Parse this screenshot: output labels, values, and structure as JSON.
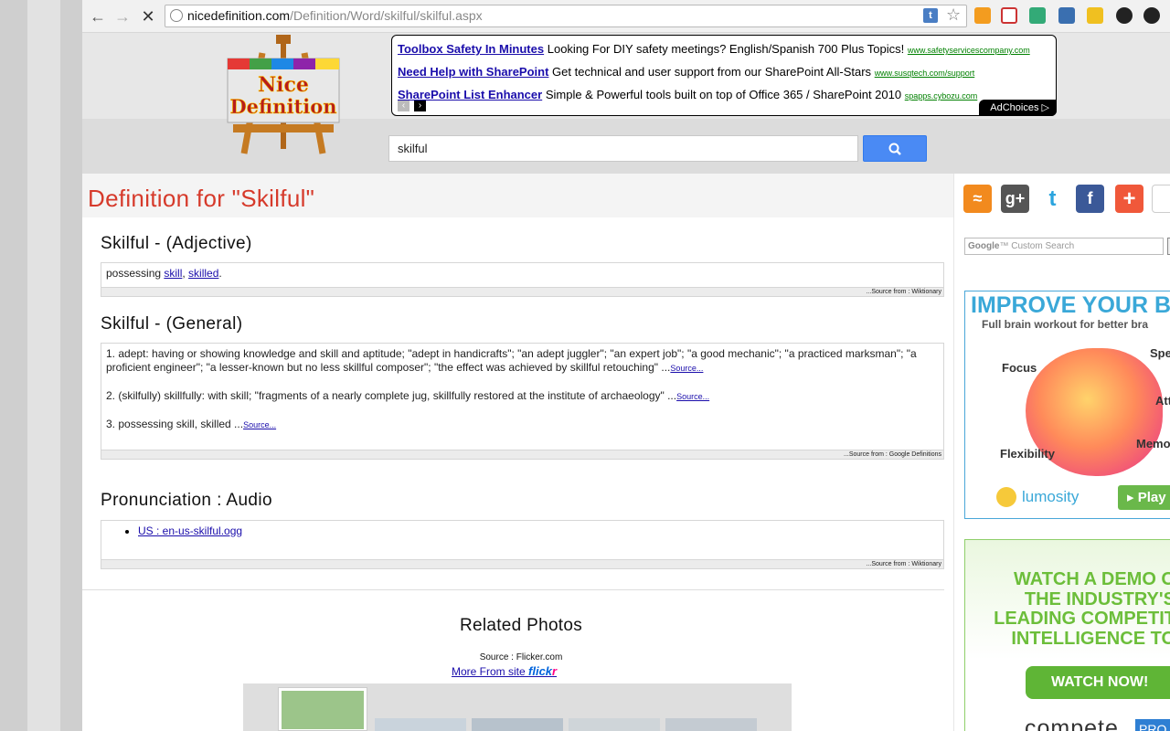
{
  "browser": {
    "url_domain": "nicedefinition.com",
    "url_path": "/Definition/Word/skilful/skilful.aspx",
    "icons": [
      "back-icon",
      "forward-icon",
      "stop-icon",
      "globe-icon",
      "star-icon"
    ]
  },
  "ads": {
    "lines": [
      {
        "title": "Toolbox Safety In Minutes",
        "text": "Looking For DIY safety meetings? English/Spanish 700 Plus Topics!",
        "domain": "www.safetyservicescompany.com"
      },
      {
        "title": "Need Help with SharePoint",
        "text": "Get technical and user support from our SharePoint All-Stars",
        "domain": "www.susqtech.com/support"
      },
      {
        "title": "SharePoint List Enhancer",
        "text": "Simple & Powerful tools built on top of Office 365 / SharePoint 2010",
        "domain": "spapps.cybozu.com"
      }
    ],
    "adchoices": "AdChoices"
  },
  "search": {
    "value": "skilful"
  },
  "page": {
    "title": "Definition for \"Skilful\"",
    "sections": [
      {
        "heading": "Skilful - (Adjective)",
        "source": "...Source from : Wiktionary"
      },
      {
        "heading": "Skilful - (General)",
        "source": "...Source from : Google Definitions"
      },
      {
        "heading": "Pronunciation : Audio",
        "source": "...Source from : Wiktionary"
      }
    ],
    "adjective": {
      "prefix": "possessing ",
      "link1": "skill",
      "sep": ", ",
      "link2": "skilled",
      "suffix": "."
    },
    "general": [
      {
        "text": "1. adept: having or showing knowledge and skill and aptitude; \"adept in handicrafts\"; \"an adept juggler\"; \"an expert job\"; \"a good mechanic\"; \"a practiced marksman\"; \"a proficient engineer\"; \"a lesser-known but no less skillful composer\"; \"the effect was achieved by skillful retouching\" ...",
        "link": "Source..."
      },
      {
        "text": "2. (skilfully) skillfully: with skill; \"fragments of a nearly complete jug, skillfully restored at the institute of archaeology\" ...",
        "link": "Source..."
      },
      {
        "text": "3. possessing skill, skilled ...",
        "link": "Source..."
      }
    ],
    "pronunciation_link": "US : en-us-skilful.ogg",
    "related_title": "Related Photos",
    "photo_source": "Source : Flicker.com",
    "photo_more": "More From site ",
    "flickr_a": "flick",
    "flickr_b": "r"
  },
  "sidebar": {
    "social": [
      "rss-icon",
      "google-plus-icon",
      "twitter-icon",
      "facebook-icon",
      "addthis-icon"
    ],
    "cse_placeholder": "Custom Search",
    "cse_brand": "Google",
    "lumosity": {
      "headline": "IMPROVE YOUR B",
      "sub": "Full brain workout for better bra",
      "labels": [
        "Focus",
        "Spe",
        "Att",
        "Flexibility",
        "Memo"
      ],
      "logo": "lumosity",
      "play": "▸ Play"
    },
    "compete": {
      "headline": "WATCH A DEMO O\nTHE INDUSTRY'S\nLEADING COMPETIT\nINTELLIGENCE TO",
      "button": "WATCH NOW!",
      "logo": "compete",
      "badge": "PRO"
    }
  },
  "colors": {
    "title_red": "#d63a2b",
    "link_blue": "#1a0dab",
    "search_blue": "#4a8af4"
  }
}
